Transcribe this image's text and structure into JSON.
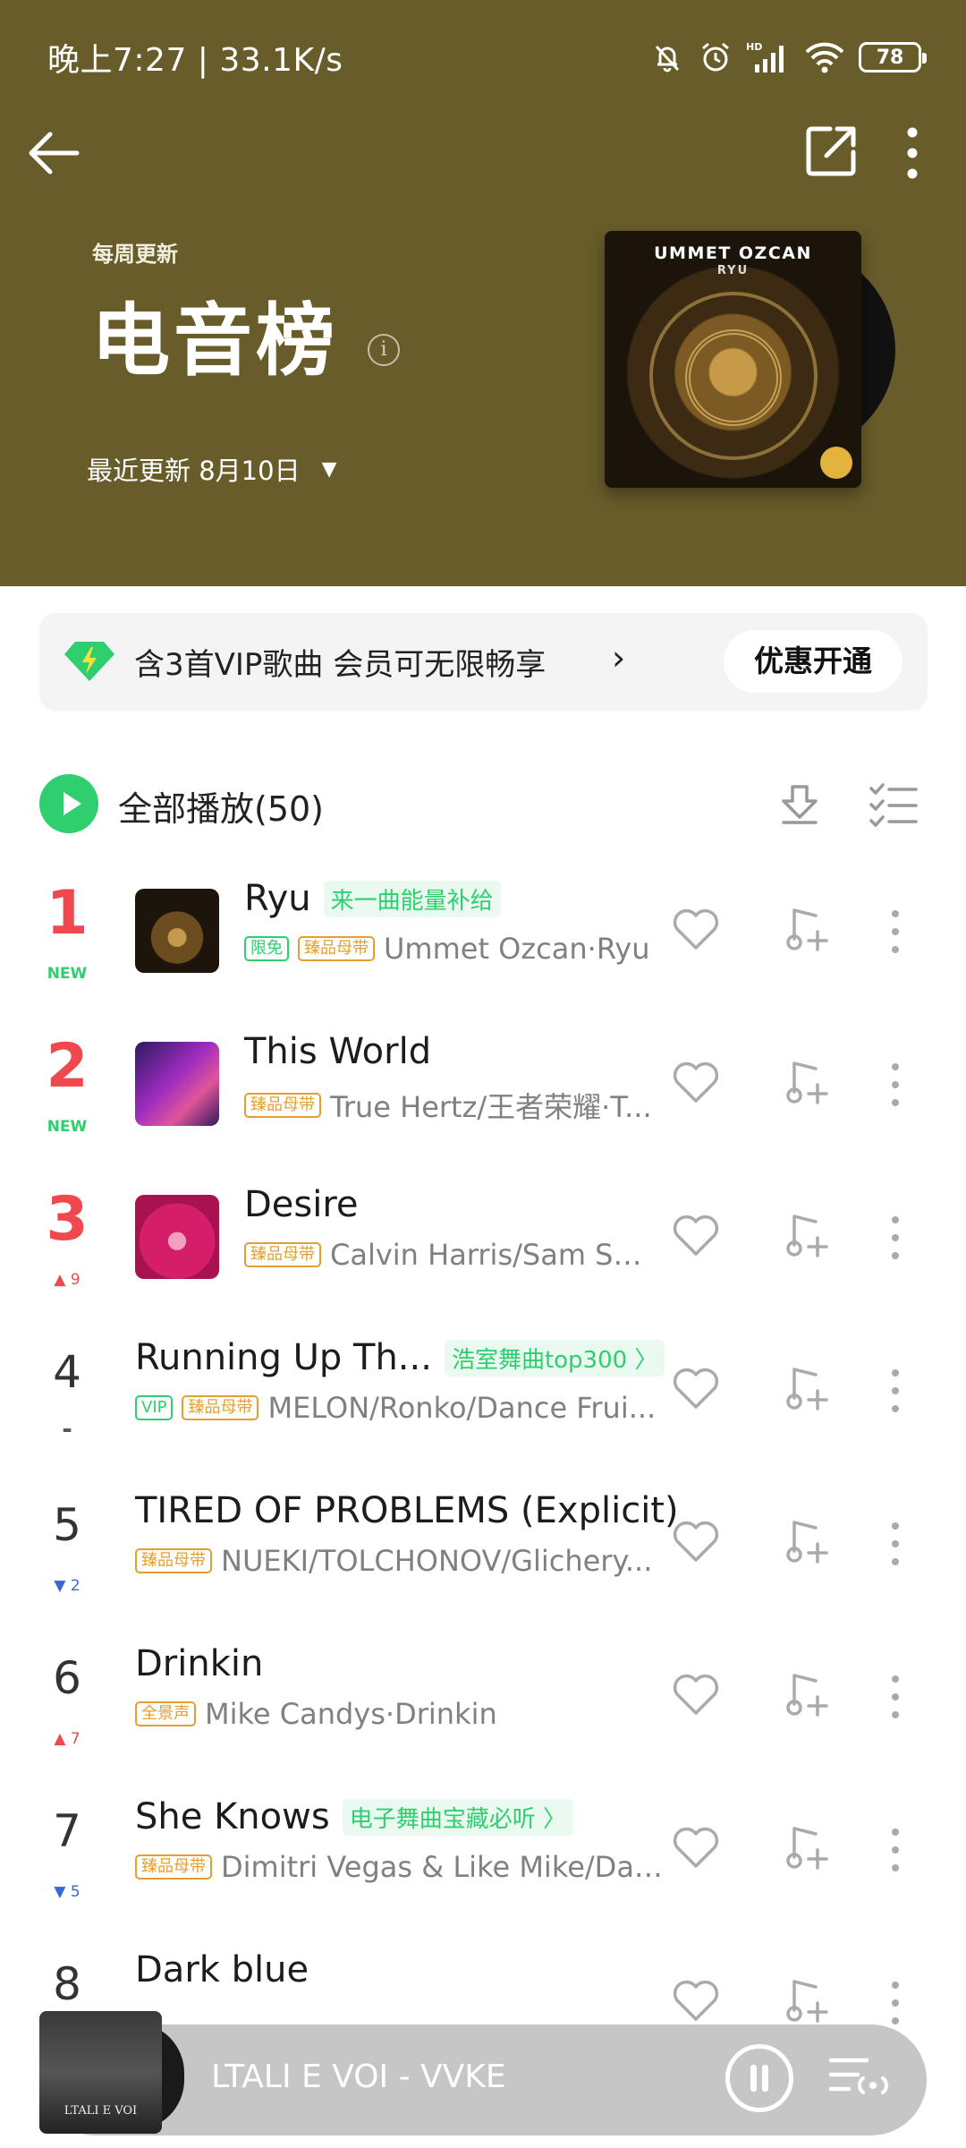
{
  "status_bar": {
    "time_speed": "晚上7:27 | 33.1K/s",
    "battery": "78",
    "icons": [
      "bell-off-icon",
      "alarm-icon",
      "hd-signal-icon",
      "wifi-icon",
      "battery-icon"
    ]
  },
  "header": {
    "weekly_label": "每周更新",
    "title": "电音榜",
    "update_label": "最近更新 8月10日",
    "cover_artist": "UMMET OZCAN",
    "cover_title": "RYU",
    "background_color": "#685c2a"
  },
  "vip_banner": {
    "text": "含3首VIP歌曲 会员可无限畅享",
    "button": "优惠开通"
  },
  "play_all": {
    "label": "全部播放(50)"
  },
  "songs": [
    {
      "rank": "1",
      "change": "NEW",
      "title": "Ryu",
      "title_tag": "来一曲能量补给",
      "tags": [
        "限免",
        "臻品母带"
      ],
      "artists": "Ummet Ozcan·Ryu"
    },
    {
      "rank": "2",
      "change": "NEW",
      "title": "This World",
      "title_tag": "",
      "tags": [
        "臻品母带"
      ],
      "artists": "True Hertz/王者荣耀·T..."
    },
    {
      "rank": "3",
      "change": "▲ 9",
      "title": "Desire",
      "title_tag": "",
      "tags": [
        "臻品母带"
      ],
      "artists": "Calvin Harris/Sam Smi..."
    },
    {
      "rank": "4",
      "change": "-",
      "title": "Running Up Th...",
      "title_tag": "浩室舞曲top300 〉",
      "tags": [
        "VIP",
        "臻品母带"
      ],
      "artists": "MELON/Ronko/Dance Frui..."
    },
    {
      "rank": "5",
      "change": "▼ 2",
      "title": "TIRED OF PROBLEMS (Explicit)",
      "title_tag": "",
      "tags": [
        "臻品母带"
      ],
      "artists": "NUEKI/TOLCHONOV/Glichery..."
    },
    {
      "rank": "6",
      "change": "▲ 7",
      "title": "Drinkin",
      "title_tag": "",
      "tags": [
        "全景声"
      ],
      "artists": "Mike Candys·Drinkin"
    },
    {
      "rank": "7",
      "change": "▼ 5",
      "title": "She Knows",
      "title_tag": "电子舞曲宝藏必听 〉",
      "tags": [
        "臻品母带"
      ],
      "artists": "Dimitri Vegas & Like Mike/Dav..."
    },
    {
      "rank": "8",
      "change": "",
      "title": "Dark blue",
      "title_tag": "",
      "tags": [],
      "artists": ""
    }
  ],
  "mini_player": {
    "now_playing": "LTALI E VOI - VVKE",
    "art_text": "LTALI E VOI"
  },
  "colors": {
    "accent_green": "#2fcf6f",
    "rank_red": "#f0484e",
    "down_blue": "#3568d4",
    "tag_orange": "#e3a031"
  }
}
